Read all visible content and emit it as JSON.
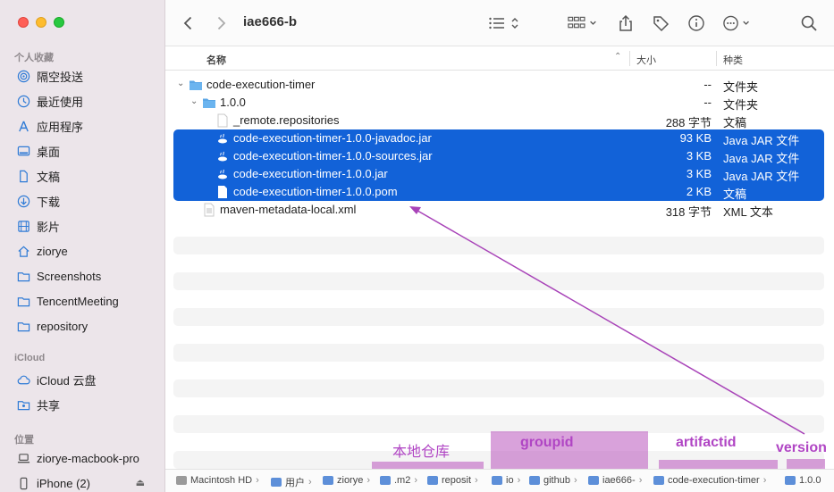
{
  "window": {
    "title": "iae666-b"
  },
  "sidebar": {
    "favorites_header": "个人收藏",
    "favorites": [
      {
        "label": "隔空投送",
        "icon": "airdrop-icon"
      },
      {
        "label": "最近使用",
        "icon": "clock-icon"
      },
      {
        "label": "应用程序",
        "icon": "applications-icon"
      },
      {
        "label": "桌面",
        "icon": "desktop-icon"
      },
      {
        "label": "文稿",
        "icon": "document-icon"
      },
      {
        "label": "下载",
        "icon": "download-icon"
      },
      {
        "label": "影片",
        "icon": "film-icon"
      },
      {
        "label": "ziorye",
        "icon": "home-icon"
      },
      {
        "label": "Screenshots",
        "icon": "folder-icon"
      },
      {
        "label": "TencentMeeting",
        "icon": "folder-icon"
      },
      {
        "label": "repository",
        "icon": "folder-icon"
      }
    ],
    "icloud_header": "iCloud",
    "icloud": [
      {
        "label": "iCloud 云盘",
        "icon": "cloud-icon"
      },
      {
        "label": "共享",
        "icon": "shared-folder-icon"
      }
    ],
    "locations_header": "位置",
    "locations": [
      {
        "label": "ziorye-macbook-pro",
        "icon": "laptop-icon"
      },
      {
        "label": "iPhone (2)",
        "icon": "phone-icon"
      }
    ]
  },
  "columns": {
    "name": "名称",
    "size": "大小",
    "kind": "种类"
  },
  "files": [
    {
      "name": "code-execution-timer",
      "size": "--",
      "kind": "文件夹",
      "type": "folder",
      "level": 0,
      "expanded": true,
      "selected": false
    },
    {
      "name": "1.0.0",
      "size": "--",
      "kind": "文件夹",
      "type": "folder",
      "level": 1,
      "expanded": true,
      "selected": false
    },
    {
      "name": "_remote.repositories",
      "size": "288 字节",
      "kind": "文稿",
      "type": "doc",
      "level": 2,
      "selected": false
    },
    {
      "name": "code-execution-timer-1.0.0-javadoc.jar",
      "size": "93 KB",
      "kind": "Java JAR 文件",
      "type": "jar",
      "level": 2,
      "selected": true
    },
    {
      "name": "code-execution-timer-1.0.0-sources.jar",
      "size": "3 KB",
      "kind": "Java JAR 文件",
      "type": "jar",
      "level": 2,
      "selected": true
    },
    {
      "name": "code-execution-timer-1.0.0.jar",
      "size": "3 KB",
      "kind": "Java JAR 文件",
      "type": "jar",
      "level": 2,
      "selected": true
    },
    {
      "name": "code-execution-timer-1.0.0.pom",
      "size": "2 KB",
      "kind": "文稿",
      "type": "doc",
      "level": 2,
      "selected": true
    },
    {
      "name": "maven-metadata-local.xml",
      "size": "318 字节",
      "kind": "XML 文本",
      "type": "xml",
      "level": 1,
      "selected": false
    }
  ],
  "pathbar": [
    {
      "label": "Macintosh HD",
      "icon": "disk-icon"
    },
    {
      "label": "用户",
      "icon": "folder-icon"
    },
    {
      "label": "ziorye",
      "icon": "home-icon"
    },
    {
      "label": ".m2",
      "icon": "folder-icon"
    },
    {
      "label": "reposit",
      "icon": "folder-icon"
    },
    {
      "label": "io",
      "icon": "folder-icon"
    },
    {
      "label": "github",
      "icon": "folder-icon"
    },
    {
      "label": "iae666-",
      "icon": "folder-icon"
    },
    {
      "label": "code-execution-timer",
      "icon": "folder-icon"
    },
    {
      "label": "1.0.0",
      "icon": "folder-icon"
    }
  ],
  "annotations": {
    "local_repo": "本地仓库",
    "groupid": "groupid",
    "artifactid": "artifactid",
    "version": "version",
    "color": "#b045c4"
  },
  "colors": {
    "selection": "#1262d8",
    "folder": "#5aa6e6",
    "sidebar_bg": "#ece5ea"
  }
}
